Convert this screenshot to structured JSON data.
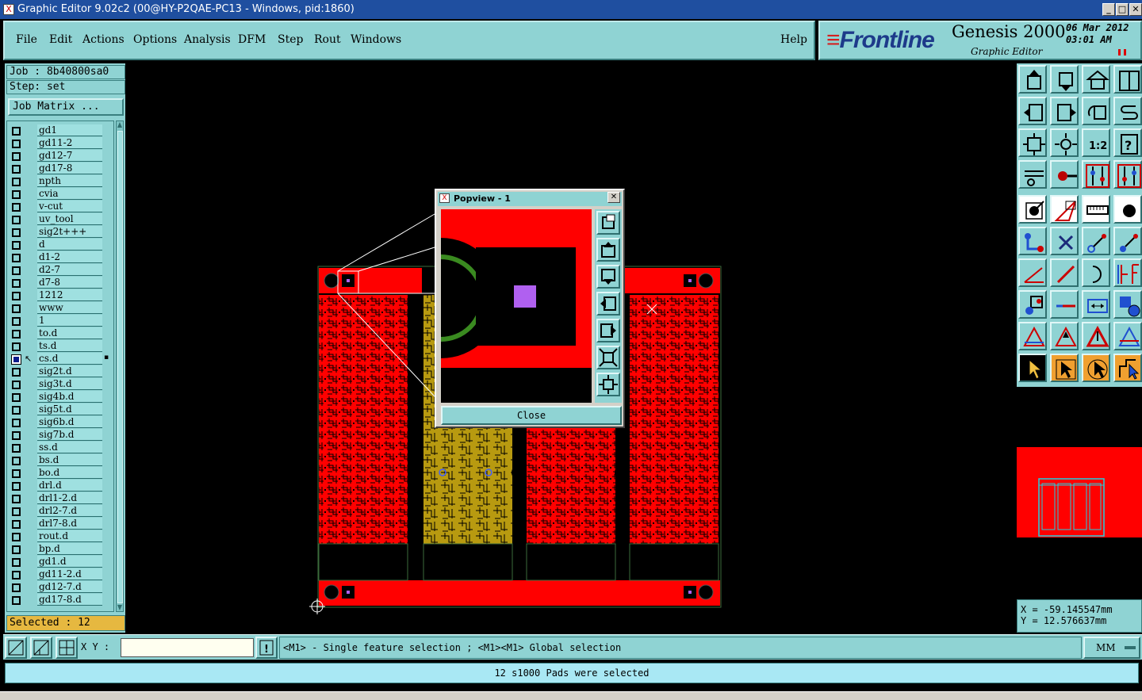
{
  "window": {
    "title": "Graphic Editor 9.02c2 (00@HY-P2QAE-PC13 - Windows, pid:1860)",
    "minimize": "_",
    "maximize": "□",
    "close": "✕"
  },
  "menu": {
    "file": "File",
    "edit": "Edit",
    "actions": "Actions",
    "options": "Options",
    "analysis": "Analysis",
    "dfm": "DFM",
    "step": "Step",
    "rout": "Rout",
    "windows": "Windows",
    "help": "Help"
  },
  "logo": {
    "brand": "Frontline",
    "product": "Genesis 2000",
    "subtitle": "Graphic Editor",
    "date": "06 Mar 2012",
    "time": "03:01 AM"
  },
  "left": {
    "job": "Job : 8b40800sa0",
    "step": "Step: set",
    "job_matrix": "Job Matrix ...",
    "selected": "Selected : 12",
    "layers": [
      {
        "name": "gd1",
        "active": false
      },
      {
        "name": "gd11-2",
        "active": false
      },
      {
        "name": "gd12-7",
        "active": false
      },
      {
        "name": "gd17-8",
        "active": false
      },
      {
        "name": "npth",
        "active": false
      },
      {
        "name": "cvia",
        "active": false
      },
      {
        "name": "v-cut",
        "active": false
      },
      {
        "name": "uv_tool",
        "active": false
      },
      {
        "name": "sig2t+++",
        "active": false
      },
      {
        "name": "d",
        "active": false
      },
      {
        "name": "d1-2",
        "active": false
      },
      {
        "name": "d2-7",
        "active": false
      },
      {
        "name": "d7-8",
        "active": false
      },
      {
        "name": "1212",
        "active": false
      },
      {
        "name": "www",
        "active": false
      },
      {
        "name": "1",
        "active": false
      },
      {
        "name": "to.d",
        "active": false
      },
      {
        "name": "ts.d",
        "active": false
      },
      {
        "name": "cs.d",
        "active": true
      },
      {
        "name": "sig2t.d",
        "active": false
      },
      {
        "name": "sig3t.d",
        "active": false
      },
      {
        "name": "sig4b.d",
        "active": false
      },
      {
        "name": "sig5t.d",
        "active": false
      },
      {
        "name": "sig6b.d",
        "active": false
      },
      {
        "name": "sig7b.d",
        "active": false
      },
      {
        "name": "ss.d",
        "active": false
      },
      {
        "name": "bs.d",
        "active": false
      },
      {
        "name": "bo.d",
        "active": false
      },
      {
        "name": "drl.d",
        "active": false
      },
      {
        "name": "drl1-2.d",
        "active": false
      },
      {
        "name": "drl2-7.d",
        "active": false
      },
      {
        "name": "drl7-8.d",
        "active": false
      },
      {
        "name": "rout.d",
        "active": false
      },
      {
        "name": "bp.d",
        "active": false
      },
      {
        "name": "gd1.d",
        "active": false
      },
      {
        "name": "gd11-2.d",
        "active": false
      },
      {
        "name": "gd12-7.d",
        "active": false
      },
      {
        "name": "gd17-8.d",
        "active": false
      }
    ]
  },
  "popview": {
    "title": "Popview - 1",
    "close_label": "Close"
  },
  "coords": {
    "x": "X = -59.145547mm",
    "y": "Y = 12.576637mm"
  },
  "bottom": {
    "xy_label": "X Y :",
    "xy_value": "",
    "hint": "<M1> - Single feature selection ; <M1><M1> Global selection",
    "units": "MM",
    "status": "12 s1000 Pads were selected"
  },
  "colors": {
    "panel": "#8fd3d3",
    "copper_red": "#ff0000",
    "copper_gold": "#b89a10",
    "selected_pad": "#b060f0"
  }
}
